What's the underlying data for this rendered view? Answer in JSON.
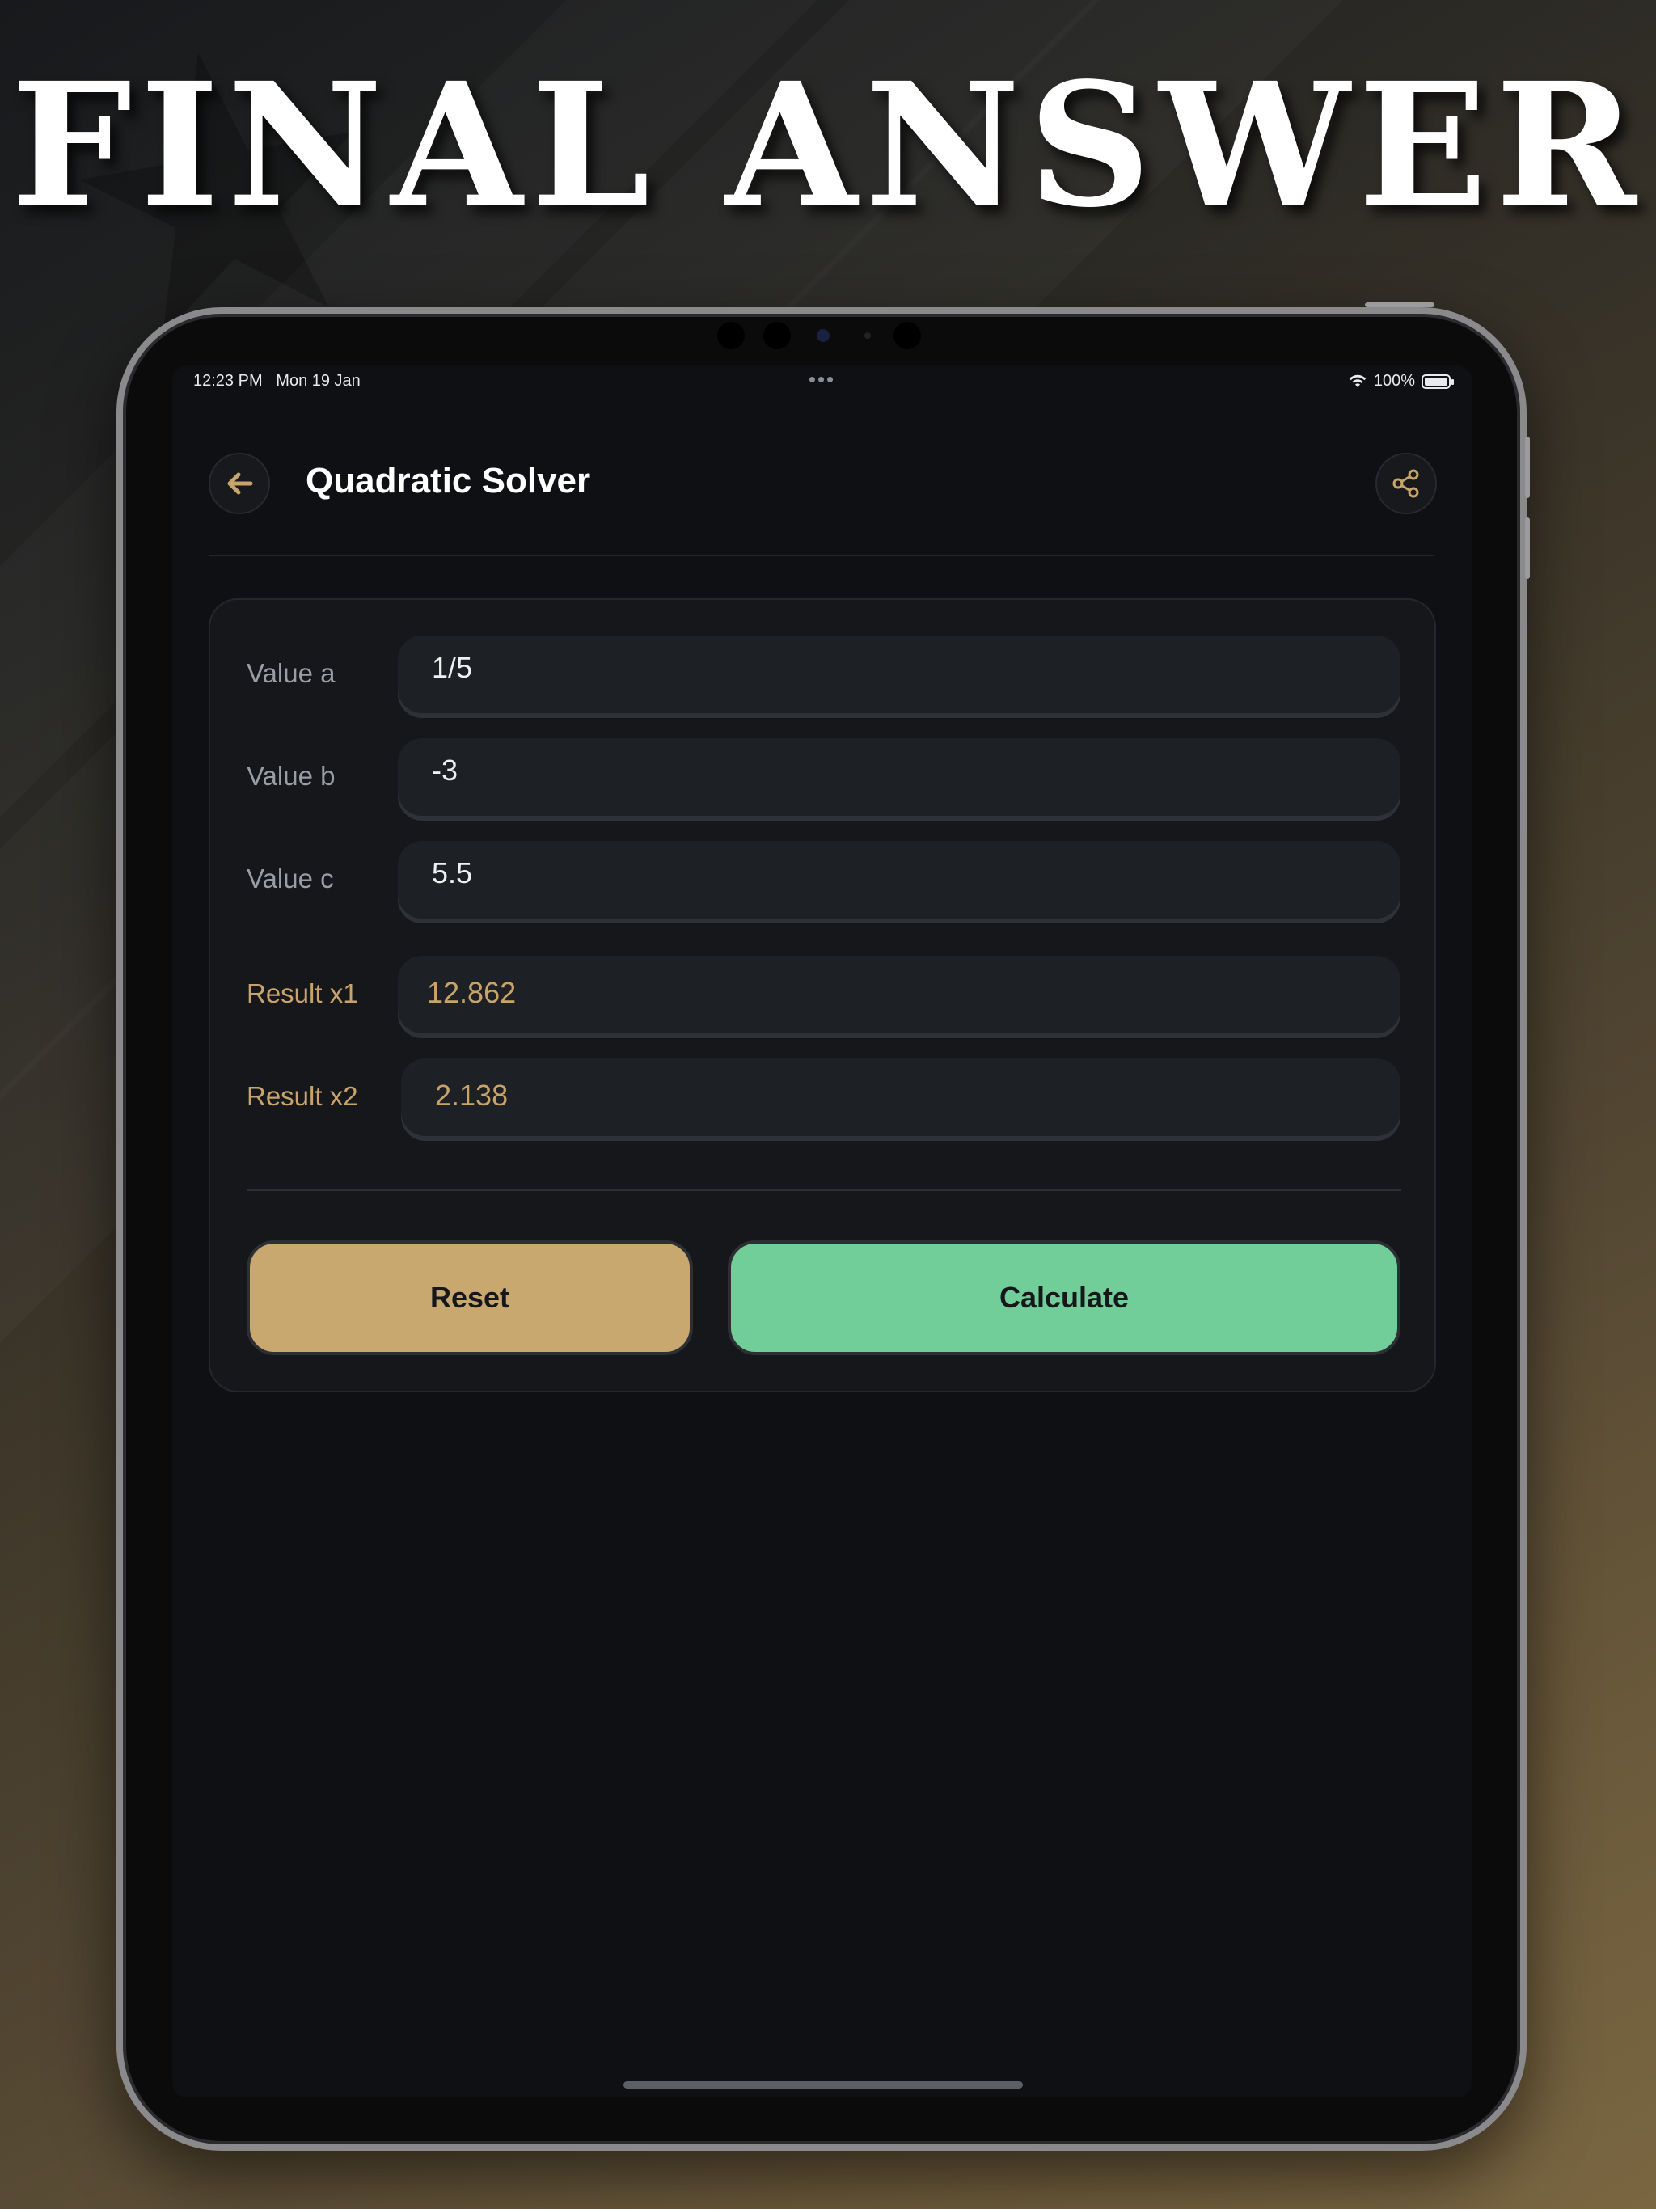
{
  "headline": "FINAL ANSWER",
  "status_bar": {
    "time": "12:23 PM",
    "date": "Mon 19 Jan",
    "dots": "•••",
    "battery_percent": "100%",
    "wifi_icon": "wifi-icon",
    "battery_icon": "battery-icon"
  },
  "app_bar": {
    "title": "Quadratic Solver",
    "back_icon": "arrow-left-icon",
    "share_icon": "share-icon"
  },
  "inputs": {
    "a": {
      "label": "Value a",
      "value": "1/5"
    },
    "b": {
      "label": "Value b",
      "value": "-3"
    },
    "c": {
      "label": "Value c",
      "value": "5.5"
    }
  },
  "results": {
    "x1": {
      "label": "Result x1",
      "value": "12.862"
    },
    "x2": {
      "label": "Result x2",
      "value": "2.138"
    }
  },
  "buttons": {
    "reset": "Reset",
    "calculate": "Calculate"
  },
  "colors": {
    "accent_gold": "#c9a46a",
    "reset_button": "#c9a870",
    "calculate_button": "#72ce98",
    "screen_background": "#0e1013",
    "card_background": "#15171a"
  }
}
